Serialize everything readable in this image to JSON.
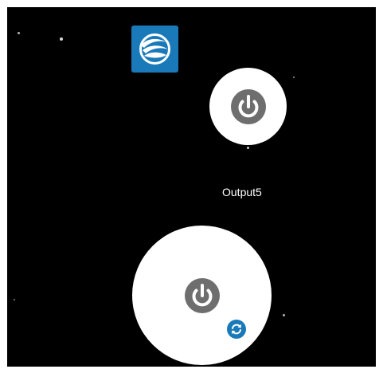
{
  "outputs": [
    {
      "label": "Output5"
    }
  ],
  "icons": {
    "app_logo": "app-logo-icon",
    "power": "power-icon",
    "refresh": "refresh-icon"
  },
  "colors": {
    "background": "#000000",
    "card": "#ffffff",
    "power_icon": "#6e6e6e",
    "logo": "#1a79b8",
    "refresh_badge": "#1a79b8",
    "label_text": "#ffffff"
  }
}
